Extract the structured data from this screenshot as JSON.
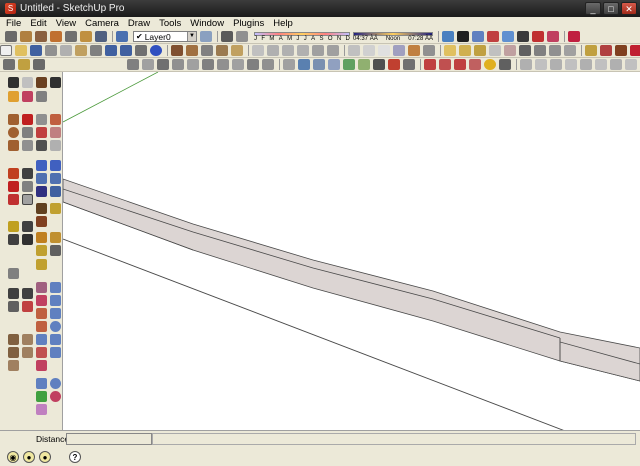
{
  "window": {
    "title": "Untitled - SketchUp Pro",
    "minimize": "_",
    "maximize": "□",
    "close": "✕"
  },
  "menu": [
    "File",
    "Edit",
    "View",
    "Camera",
    "Draw",
    "Tools",
    "Window",
    "Plugins",
    "Help"
  ],
  "layers": {
    "current_layer": "Layer0"
  },
  "shadows": {
    "months": [
      "J",
      "F",
      "M",
      "A",
      "M",
      "J",
      "J",
      "A",
      "S",
      "O",
      "N",
      "D"
    ],
    "time_start": "04:37",
    "time_start_suffix": "ÀÄ",
    "time_mid": "Noon",
    "time_end": "07:28",
    "time_end_suffix": "ÀÄ"
  },
  "statusbar": {
    "vcb_label": "Distance",
    "vcb_value": "",
    "status_text": ""
  },
  "colors": {
    "road_fill": "#dcd5d3",
    "road_edge": "#4a4a4a",
    "axis_green": "#4c9a3c"
  }
}
